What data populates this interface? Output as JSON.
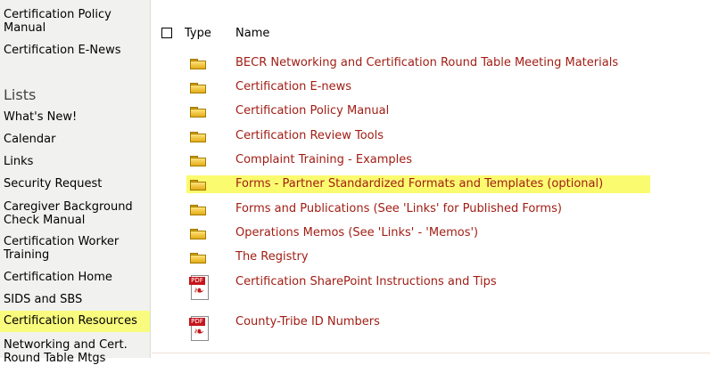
{
  "sidebar": {
    "top_items": [
      "Certification Policy\nManual",
      "Certification E-News"
    ],
    "lists_heading": "Lists",
    "list_items": [
      "What's New!",
      "Calendar",
      "Links",
      "Security Request",
      "Caregiver Background Check Manual",
      "Certification Worker Training",
      "Certification Home",
      "SIDS and SBS",
      "Certification Resources",
      "Networking and Cert. Round Table Mtgs"
    ],
    "selected": "Certification Resources"
  },
  "table": {
    "columns": [
      "Type",
      "Name"
    ],
    "rows": [
      {
        "type": "folder",
        "name": "BECR Networking and Certification Round Table Meeting Materials"
      },
      {
        "type": "folder",
        "name": "Certification E-news"
      },
      {
        "type": "folder",
        "name": "Certification Policy Manual"
      },
      {
        "type": "folder",
        "name": "Certification Review Tools"
      },
      {
        "type": "folder",
        "name": "Complaint Training - Examples"
      },
      {
        "type": "folder",
        "name": "Forms - Partner Standardized Formats and Templates (optional)",
        "highlighted": true
      },
      {
        "type": "folder",
        "name": "Forms and Publications (See 'Links' for Published Forms)"
      },
      {
        "type": "folder",
        "name": "Operations Memos (See 'Links' - 'Memos')"
      },
      {
        "type": "folder",
        "name": "The Registry"
      },
      {
        "type": "pdf",
        "name": "Certification SharePoint Instructions and Tips"
      },
      {
        "type": "pdf",
        "name": "County-Tribe ID Numbers"
      }
    ]
  },
  "icons": {
    "folder": "folder-icon",
    "pdf": "pdf-icon",
    "pdf_label": "PDF"
  },
  "colors": {
    "link": "#a11d14",
    "highlight": "#fbfb6f",
    "sidebar_bg": "#f1f1ef"
  }
}
